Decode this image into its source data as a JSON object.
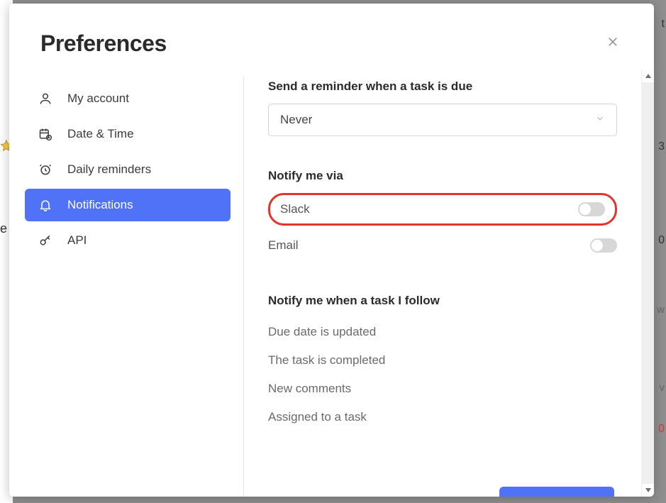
{
  "modal": {
    "title": "Preferences"
  },
  "sidebar": {
    "items": {
      "account": {
        "label": "My account"
      },
      "datetime": {
        "label": "Date & Time"
      },
      "reminders": {
        "label": "Daily reminders"
      },
      "notifications": {
        "label": "Notifications"
      },
      "api": {
        "label": "API"
      }
    },
    "active": "notifications"
  },
  "settings": {
    "reminder_section_title": "Send a reminder when a task is due",
    "reminder_value": "Never",
    "notify_via_title": "Notify me via",
    "channels": {
      "slack": {
        "label": "Slack",
        "enabled": false
      },
      "email": {
        "label": "Email",
        "enabled": false
      }
    },
    "follow_title": "Notify me when a task I follow",
    "follow_events": {
      "due_date": "Due date is updated",
      "completed": "The task is completed",
      "comments": "New comments",
      "assigned": "Assigned to a task"
    }
  },
  "bg": {
    "r1": "t",
    "r2": "3",
    "r3": "0",
    "r4": "w",
    "r5": "v",
    "r6": "0",
    "left_e": "e"
  }
}
